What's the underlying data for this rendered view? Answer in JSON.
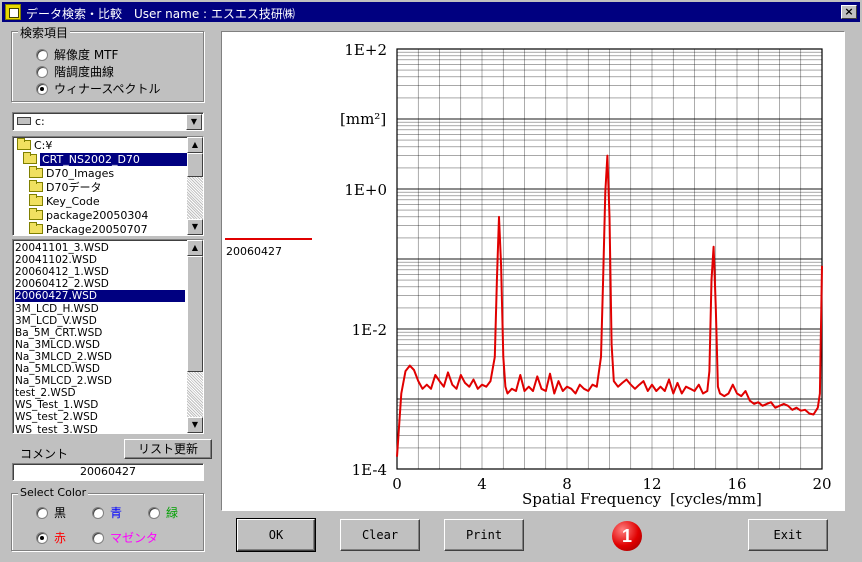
{
  "window": {
    "title": "データ検索・比較　User name : エスエス技研㈱",
    "close_label": "×"
  },
  "search_group": {
    "label": "検索項目",
    "options": [
      {
        "label": "解像度 MTF",
        "selected": false
      },
      {
        "label": "階調度曲線",
        "selected": false
      },
      {
        "label": "ウィナースペクトル",
        "selected": true
      }
    ]
  },
  "drive": {
    "value": "c:"
  },
  "dirs": [
    {
      "label": "C:¥",
      "selected": false
    },
    {
      "label": "CRT_NS2002_D70",
      "selected": true
    },
    {
      "label": "D70_Images",
      "selected": false
    },
    {
      "label": "D70データ",
      "selected": false
    },
    {
      "label": "Key_Code",
      "selected": false
    },
    {
      "label": "package20050304",
      "selected": false
    },
    {
      "label": "Package20050707",
      "selected": false
    }
  ],
  "files": [
    {
      "label": "20041101_3.WSD",
      "selected": false
    },
    {
      "label": "20041102.WSD",
      "selected": false
    },
    {
      "label": "20060412_1.WSD",
      "selected": false
    },
    {
      "label": "20060412_2.WSD",
      "selected": false
    },
    {
      "label": "20060427.WSD",
      "selected": true
    },
    {
      "label": "3M_LCD_H.WSD",
      "selected": false
    },
    {
      "label": "3M_LCD_V.WSD",
      "selected": false
    },
    {
      "label": "Ba_5M_CRT.WSD",
      "selected": false
    },
    {
      "label": "Na_3MLCD.WSD",
      "selected": false
    },
    {
      "label": "Na_3MLCD_2.WSD",
      "selected": false
    },
    {
      "label": "Na_5MLCD.WSD",
      "selected": false
    },
    {
      "label": "Na_5MLCD_2.WSD",
      "selected": false
    },
    {
      "label": "test_2.WSD",
      "selected": false
    },
    {
      "label": "WS_Test_1.WSD",
      "selected": false
    },
    {
      "label": "WS_test_2.WSD",
      "selected": false
    },
    {
      "label": "WS_test_3.WSD",
      "selected": false
    }
  ],
  "comment": {
    "label": "コメント",
    "value": "20060427"
  },
  "refresh_button": "リスト更新",
  "color_group": {
    "label": "Select Color",
    "options": [
      {
        "label": "黒",
        "color": "#000000",
        "selected": false
      },
      {
        "label": "青",
        "color": "#0000ff",
        "selected": false
      },
      {
        "label": "緑",
        "color": "#008000",
        "selected": false
      },
      {
        "label": "赤",
        "color": "#ff0000",
        "selected": true
      },
      {
        "label": "マゼンタ",
        "color": "#ff00ff",
        "selected": false
      }
    ]
  },
  "buttons": {
    "ok": "OK",
    "clear": "Clear",
    "print": "Print",
    "exit": "Exit"
  },
  "badge": "1",
  "chart_data": {
    "type": "line",
    "xlabel": "Spatial Frequency",
    "xunit": "[cycles/mm]",
    "ylabel": "[mm²]",
    "xlim": [
      0,
      20
    ],
    "ylim": [
      0.0001,
      100
    ],
    "yscale": "log",
    "grid": true,
    "x_ticks": [
      "0",
      "4",
      "8",
      "12",
      "16",
      "20"
    ],
    "y_ticks": [
      "1E-4",
      "1E-2",
      "1E+0",
      "1E+2"
    ],
    "legend_position": "left-outside",
    "series": [
      {
        "name": "20060427",
        "color": "#e00000",
        "x": [
          0,
          0.2,
          0.4,
          0.6,
          0.8,
          1.0,
          1.2,
          1.4,
          1.6,
          1.8,
          2.0,
          2.2,
          2.4,
          2.6,
          2.8,
          3.0,
          3.2,
          3.4,
          3.6,
          3.8,
          4.0,
          4.2,
          4.4,
          4.6,
          4.7,
          4.8,
          4.9,
          5.0,
          5.1,
          5.2,
          5.4,
          5.6,
          5.8,
          6.0,
          6.2,
          6.4,
          6.6,
          6.8,
          7.0,
          7.2,
          7.4,
          7.6,
          7.8,
          8.0,
          8.2,
          8.4,
          8.6,
          8.8,
          9.0,
          9.2,
          9.4,
          9.6,
          9.7,
          9.8,
          9.9,
          10.0,
          10.1,
          10.2,
          10.4,
          10.6,
          10.8,
          11.0,
          11.2,
          11.4,
          11.6,
          11.8,
          12.0,
          12.2,
          12.4,
          12.6,
          12.8,
          13.0,
          13.2,
          13.4,
          13.6,
          13.8,
          14.0,
          14.2,
          14.4,
          14.6,
          14.7,
          14.8,
          14.9,
          15.0,
          15.1,
          15.2,
          15.4,
          15.6,
          15.8,
          16.0,
          16.2,
          16.4,
          16.6,
          16.8,
          17.0,
          17.2,
          17.4,
          17.6,
          17.8,
          18.0,
          18.2,
          18.4,
          18.6,
          18.8,
          19.0,
          19.2,
          19.4,
          19.6,
          19.8,
          19.9,
          20.0
        ],
        "y": [
          0.00015,
          0.0012,
          0.0025,
          0.003,
          0.0026,
          0.0018,
          0.0014,
          0.0016,
          0.0014,
          0.0022,
          0.0018,
          0.0015,
          0.0024,
          0.0016,
          0.0014,
          0.0022,
          0.0017,
          0.0015,
          0.0019,
          0.0014,
          0.0016,
          0.0015,
          0.0018,
          0.004,
          0.05,
          0.4,
          0.08,
          0.004,
          0.0015,
          0.0012,
          0.0014,
          0.0013,
          0.0022,
          0.0013,
          0.0015,
          0.0013,
          0.0021,
          0.0014,
          0.0013,
          0.0023,
          0.0012,
          0.0018,
          0.0013,
          0.0015,
          0.0014,
          0.0012,
          0.0016,
          0.0014,
          0.0013,
          0.0016,
          0.0015,
          0.004,
          0.05,
          0.9,
          3.0,
          0.4,
          0.006,
          0.0018,
          0.0015,
          0.0017,
          0.0019,
          0.0016,
          0.0014,
          0.0016,
          0.0018,
          0.0013,
          0.0016,
          0.0013,
          0.0015,
          0.0013,
          0.0019,
          0.0012,
          0.0017,
          0.0012,
          0.0015,
          0.0014,
          0.0013,
          0.0016,
          0.0012,
          0.0013,
          0.0025,
          0.05,
          0.15,
          0.02,
          0.0015,
          0.0012,
          0.0011,
          0.0012,
          0.0016,
          0.0012,
          0.0011,
          0.0013,
          0.00095,
          0.00085,
          0.0009,
          0.0008,
          0.00085,
          0.0009,
          0.00075,
          0.0008,
          0.00085,
          0.0008,
          0.0007,
          0.00075,
          0.00068,
          0.0007,
          0.00062,
          0.0006,
          0.00075,
          0.0012,
          0.08
        ]
      }
    ]
  }
}
